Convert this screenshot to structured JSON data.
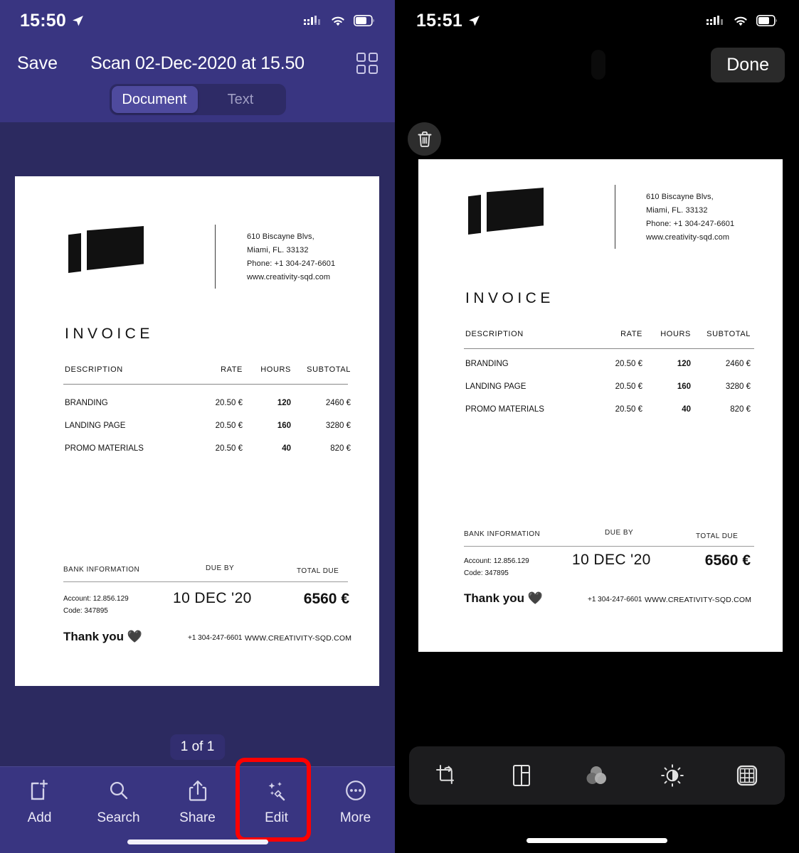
{
  "left_phone": {
    "status_bar": {
      "time": "15:50",
      "location_icon": "location-arrow-icon",
      "cellular_icon": "cellular-signal-icon",
      "wifi_icon": "wifi-icon",
      "battery_icon": "battery-icon"
    },
    "nav": {
      "save_label": "Save",
      "title": "Scan 02-Dec-2020 at 15.50",
      "grid_icon": "grid-view-icon"
    },
    "segmented_control": {
      "options": [
        "Document",
        "Text"
      ],
      "selected": "Document"
    },
    "page_badge": "1 of 1",
    "toolbar": [
      {
        "label": "Add",
        "icon": "add-page-icon"
      },
      {
        "label": "Search",
        "icon": "search-icon"
      },
      {
        "label": "Share",
        "icon": "share-icon"
      },
      {
        "label": "Edit",
        "icon": "magic-wand-icon"
      },
      {
        "label": "More",
        "icon": "more-ellipsis-icon"
      }
    ],
    "highlight": {
      "target": "Edit",
      "color": "#ff0000"
    }
  },
  "right_phone": {
    "status_bar": {
      "time": "15:51",
      "location_icon": "location-arrow-icon",
      "cellular_icon": "cellular-signal-icon",
      "wifi_icon": "wifi-icon",
      "battery_icon": "battery-icon"
    },
    "done_label": "Done",
    "trash_icon": "trash-icon",
    "toolbar": [
      {
        "icon": "crop-rotate-icon",
        "name": "crop-rotate-tool"
      },
      {
        "icon": "filter-document-icon",
        "name": "filter-tool"
      },
      {
        "icon": "color-circles-icon",
        "name": "color-tool"
      },
      {
        "icon": "brightness-icon",
        "name": "brightness-tool"
      },
      {
        "icon": "grid-frame-icon",
        "name": "markup-tool"
      }
    ]
  },
  "invoice": {
    "address": [
      "610 Biscayne Blvs,",
      "Miami, FL. 33132",
      "Phone: +1 304-247-6601",
      "www.creativity-sqd.com"
    ],
    "title": "INVOICE",
    "table": {
      "headers": [
        "DESCRIPTION",
        "RATE",
        "HOURS",
        "SUBTOTAL"
      ],
      "rows": [
        {
          "description": "BRANDING",
          "rate": "20.50 €",
          "hours": "120",
          "subtotal": "2460 €"
        },
        {
          "description": "LANDING PAGE",
          "rate": "20.50 €",
          "hours": "160",
          "subtotal": "3280 €"
        },
        {
          "description": "PROMO MATERIALS",
          "rate": "20.50 €",
          "hours": "40",
          "subtotal": "820 €"
        }
      ]
    },
    "footer": {
      "headers": [
        "BANK INFORMATION",
        "DUE BY",
        "TOTAL DUE"
      ],
      "account": "Account: 12.856.129",
      "code": "Code: 347895",
      "due_date": "10 DEC '20",
      "total_due": "6560 €",
      "thanks": "Thank you 🖤",
      "phone": "+1 304-247-6601",
      "website": "WWW.CREATIVITY-SQD.COM"
    }
  },
  "colors": {
    "left_header": "#393581",
    "left_body": "#2c2a60",
    "segment_active": "#4e4a9e",
    "highlight_red": "#ff0000",
    "right_bg": "#000000",
    "right_toolbar": "#1c1c1e"
  }
}
